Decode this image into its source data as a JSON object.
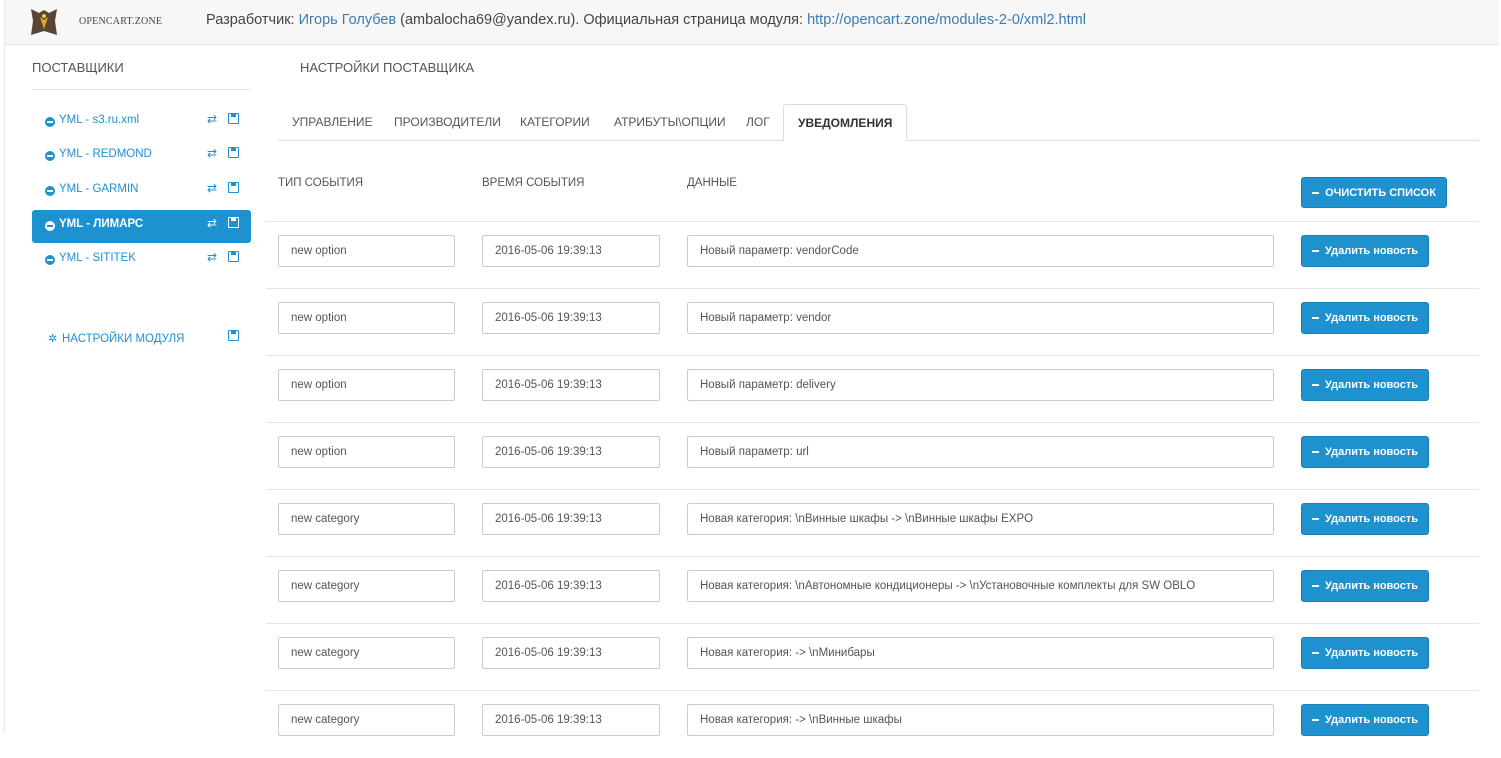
{
  "header": {
    "logo_text": "OPENCART.ZONE",
    "dev_prefix": "Разработчик: ",
    "dev_name": "Игорь Голубев",
    "dev_email": " (ambalocha69@yandex.ru). Официальная страница модуля: ",
    "module_url": "http://opencart.zone/modules-2-0/xml2.html"
  },
  "sidebar": {
    "title": "ПОСТАВЩИКИ",
    "items": [
      {
        "label": "YML - s3.ru.xml",
        "active": false
      },
      {
        "label": "YML - REDMOND",
        "active": false
      },
      {
        "label": "YML - GARMIN",
        "active": false
      },
      {
        "label": "YML - ЛИМАРС",
        "active": true
      },
      {
        "label": "YML - SITITEK",
        "active": false
      }
    ],
    "module_settings": "НАСТРОЙКИ МОДУЛЯ"
  },
  "main": {
    "title": "НАСТРОЙКИ ПОСТАВЩИКА",
    "tabs": [
      {
        "label": "УПРАВЛЕНИЕ"
      },
      {
        "label": "ПРОИЗВОДИТЕЛИ"
      },
      {
        "label": "КАТЕГОРИИ"
      },
      {
        "label": "АТРИБУТЫ\\ОПЦИИ"
      },
      {
        "label": "ЛОГ"
      },
      {
        "label": "УВЕДОМЛЕНИЯ",
        "active": true
      }
    ],
    "columns": {
      "type": "ТИП СОБЫТИЯ",
      "time": "ВРЕМЯ СОБЫТИЯ",
      "data": "ДАННЫЕ"
    },
    "clear_button": "ОЧИСТИТЬ СПИСОК",
    "delete_button": "Удалить новость",
    "rows": [
      {
        "type": "new option",
        "time": "2016-05-06 19:39:13",
        "data": "Новый параметр: vendorCode"
      },
      {
        "type": "new option",
        "time": "2016-05-06 19:39:13",
        "data": "Новый параметр: vendor"
      },
      {
        "type": "new option",
        "time": "2016-05-06 19:39:13",
        "data": "Новый параметр: delivery"
      },
      {
        "type": "new option",
        "time": "2016-05-06 19:39:13",
        "data": "Новый параметр: url"
      },
      {
        "type": "new category",
        "time": "2016-05-06 19:39:13",
        "data": "Новая категория: \\nВинные шкафы -> \\nВинные шкафы EXPO"
      },
      {
        "type": "new category",
        "time": "2016-05-06 19:39:13",
        "data": "Новая категория: \\nАвтономные кондиционеры -> \\nУстановочные комплекты для SW OBLO"
      },
      {
        "type": "new category",
        "time": "2016-05-06 19:39:13",
        "data": "Новая категория: -> \\nМинибары"
      },
      {
        "type": "new category",
        "time": "2016-05-06 19:39:13",
        "data": "Новая категория: -> \\nВинные шкафы"
      }
    ]
  },
  "colors": {
    "accent": "#1e91cf",
    "link": "#3a7cb5"
  }
}
